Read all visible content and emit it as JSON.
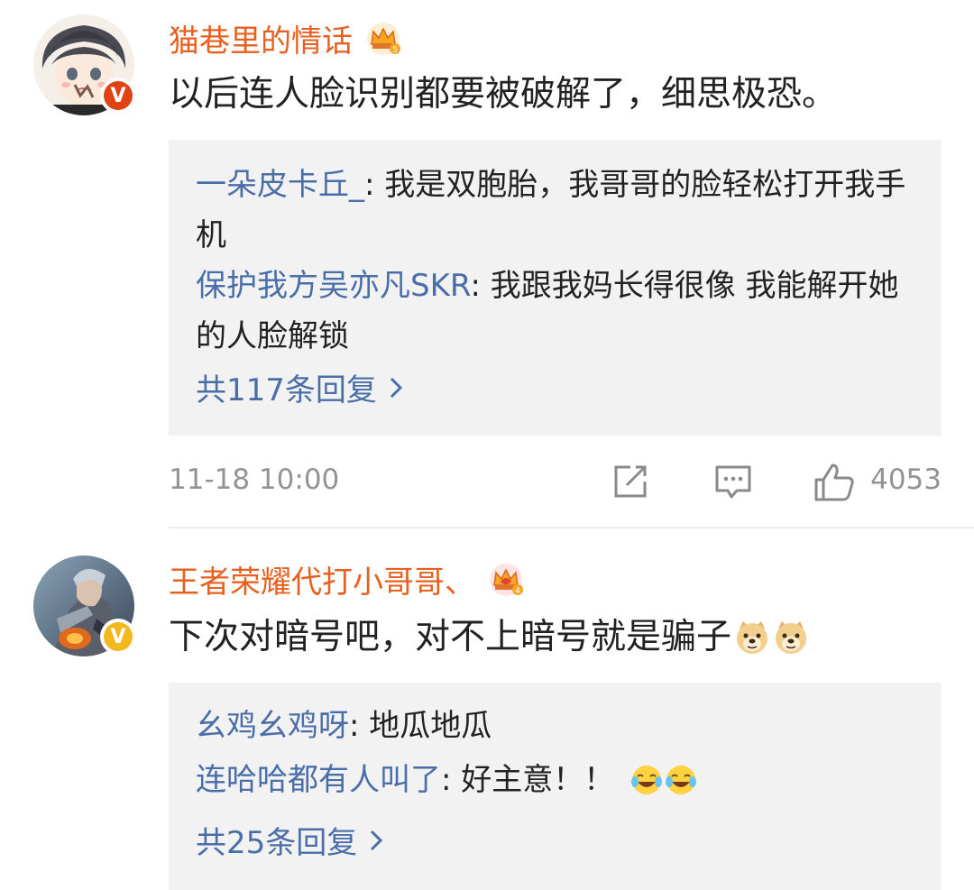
{
  "comments": [
    {
      "username": "猫巷里的情话",
      "crown_level": "5",
      "badge_color": "#e04214",
      "text": "以后连人脸识别都要被破解了，细思极恐。",
      "replies": [
        {
          "name": "一朵皮卡丘_",
          "text": ": 我是双胞胎，我哥哥的脸轻松打开我手机"
        },
        {
          "name": "保护我方吴亦凡SKR",
          "text": ": 我跟我妈长得很像 我能解开她的人脸解锁"
        }
      ],
      "more_replies": "共117条回复",
      "time": "11-18 10:00",
      "likes": "4053"
    },
    {
      "username": "王者荣耀代打小哥哥、",
      "crown_level": "4",
      "badge_color": "#f2b81e",
      "text": "下次对暗号吧，对不上暗号就是骗子",
      "text_emojis": [
        "doge-emoji",
        "doge-emoji"
      ],
      "replies": [
        {
          "name": "幺鸡幺鸡呀",
          "text": ": 地瓜地瓜"
        },
        {
          "name": "连哈哈都有人叫了",
          "text": ": 好主意！！",
          "emojis": [
            "laugh-cry-emoji",
            "laugh-cry-emoji"
          ]
        }
      ],
      "more_replies": "共25条回复"
    }
  ],
  "colors": {
    "username": "#e8601f",
    "reply_name": "#4a6ea8",
    "reply_bg": "#f2f2f2",
    "meta_text": "#939393"
  },
  "icons": {
    "crown": "crown-icon",
    "share": "share-icon",
    "comment": "comment-icon",
    "like": "thumbs-up-icon",
    "chevron": "chevron-right-icon"
  }
}
